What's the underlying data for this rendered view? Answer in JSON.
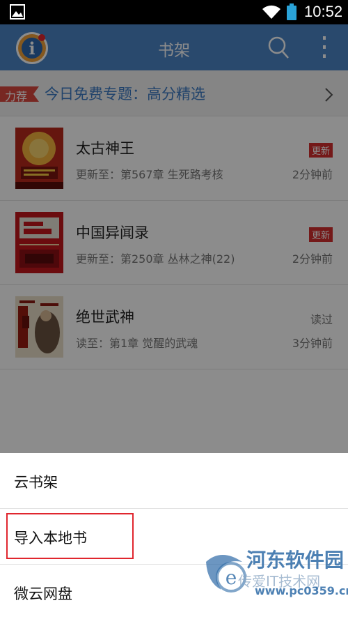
{
  "status_bar": {
    "time": "10:52",
    "icons": [
      "gallery-icon",
      "wifi-icon",
      "battery-icon"
    ]
  },
  "header": {
    "title": "书架",
    "logo_icon": "app-logo",
    "search_icon": "search-icon",
    "more_icon": "more-vertical-icon",
    "color": "#4c86c6"
  },
  "promo": {
    "tag": "力荐",
    "text": "今日免费专题：高分精选",
    "tag_color": "#d9473f"
  },
  "books": [
    {
      "title": "太古神王",
      "progress": "更新至：第567章 生死路考核",
      "badge": "更新",
      "status": "",
      "time": "2分钟前"
    },
    {
      "title": "中国异闻录",
      "progress": "更新至：第250章 丛林之神(22)",
      "badge": "更新",
      "status": "",
      "time": "2分钟前"
    },
    {
      "title": "绝世武神",
      "progress": "读至：第1章 觉醒的武魂",
      "badge": "",
      "status": "读过",
      "time": "3分钟前"
    }
  ],
  "action_sheet": {
    "items": [
      "云书架",
      "导入本地书",
      "微云网盘"
    ],
    "highlighted_item": "导入本地书",
    "highlight_color": "#e0262e"
  },
  "watermark": {
    "name": "河东软件园",
    "sub": "传爱IT技术网",
    "url": "www.pc0359.cn"
  }
}
